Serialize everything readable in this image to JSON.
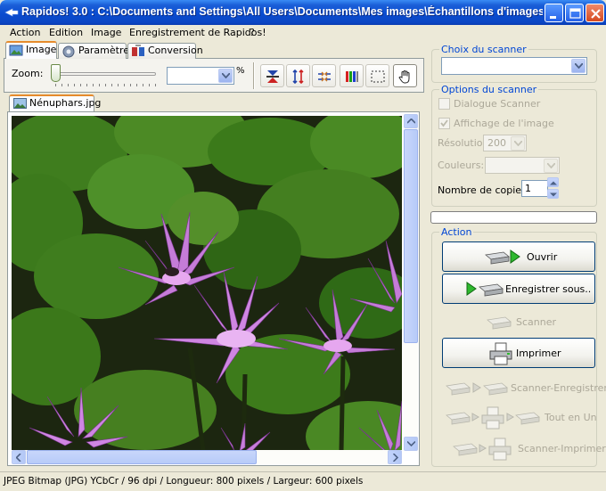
{
  "window": {
    "title": "Rapidos! 3.0 : C:\\Documents and Settings\\All Users\\Documents\\Mes images\\Échantillons d'images\\Nénu...",
    "controls": [
      "minimize",
      "maximize",
      "close"
    ]
  },
  "menu": [
    {
      "label": "Action",
      "underline": "A"
    },
    {
      "label": "Edition",
      "underline": "E"
    },
    {
      "label": "Image",
      "underline": "I"
    },
    {
      "label": "Enregistrement de Rapidos!",
      "underline": ""
    },
    {
      "label": "?",
      "underline": ""
    }
  ],
  "tabs": [
    {
      "label": "Image",
      "icon": "image-icon",
      "active": true
    },
    {
      "label": "Paramètres",
      "icon": "gear-icon",
      "active": false
    },
    {
      "label": "Conversion",
      "icon": "conversion-icon",
      "active": false
    }
  ],
  "toolbar": {
    "zoom_label": "Zoom:",
    "zoom_percent": "%",
    "zoom_value": "",
    "zoom_slider_level": 0,
    "tools": [
      {
        "name": "fit-width-icon",
        "active": false
      },
      {
        "name": "fit-height-icon",
        "active": false
      },
      {
        "name": "fit-all-icon",
        "active": false
      },
      {
        "name": "color-icon",
        "active": false
      },
      {
        "name": "selection-icon",
        "active": false
      },
      {
        "name": "hand-icon",
        "active": true
      }
    ]
  },
  "document": {
    "file_tab": "Nénuphars.jpg"
  },
  "scanner": {
    "choice_legend": "Choix du scanner",
    "choice_value": "",
    "options_legend": "Options  du scanner",
    "dialogue_label": "Dialogue Scanner",
    "affichage_label": "Affichage de l'image",
    "resolution_label": "Résolution:",
    "resolution_value": "200",
    "couleurs_label": "Couleurs:",
    "couleurs_value": "",
    "copies_label": "Nombre de copies:",
    "copies_value": "1"
  },
  "action": {
    "legend": "Action",
    "buttons": [
      {
        "label": "Ouvrir",
        "enabled": true
      },
      {
        "label": "Enregistrer sous..",
        "enabled": true
      },
      {
        "label": "Scanner",
        "enabled": false
      },
      {
        "label": "Imprimer",
        "enabled": true
      },
      {
        "label": "Scanner-Enregistrer",
        "enabled": false
      },
      {
        "label": "Tout en Un",
        "enabled": false
      },
      {
        "label": "Scanner-Imprimer",
        "enabled": false
      }
    ]
  },
  "status": {
    "text": "JPEG Bitmap (JPG) YCbCr / 96 dpi / Longueur: 800 pixels / Largeur: 600 pixels"
  },
  "colors": {
    "titlebar": "#0a4cd0",
    "accent_tab": "#e68b2c",
    "group_legend": "#0046d5",
    "disabled_text": "#aca899",
    "window_face": "#ece9d8"
  }
}
